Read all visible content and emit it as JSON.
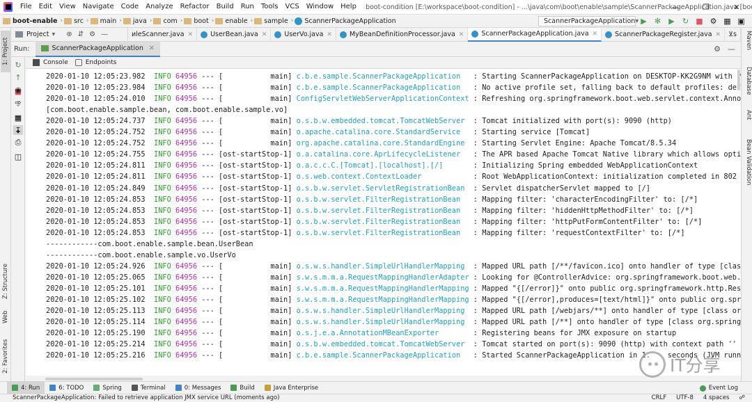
{
  "titlebar": {
    "menus": [
      "File",
      "Edit",
      "View",
      "Navigate",
      "Code",
      "Analyze",
      "Refactor",
      "Build",
      "Run",
      "Tools",
      "VCS",
      "Window",
      "Help"
    ],
    "title": "boot-condition [E:\\workspace\\boot-condition] - ...\\java\\com\\boot\\enable\\sample\\ScannerPackageApplication.java [boot-enable]"
  },
  "navbar": {
    "crumbs": [
      "boot-enable",
      "src",
      "main",
      "java",
      "com",
      "boot",
      "enable",
      "sample",
      "ScannerPackageApplication"
    ],
    "run_config": "ScannerPackageApplication"
  },
  "tabrow": {
    "project_label": "Project",
    "tabs": [
      "иleScanner.java",
      "UserBean.java",
      "UserVo.java",
      "MyBeanDefinitionProcessor.java",
      "ScannerPackageApplication.java",
      "ScannerPackageRegister.java",
      "⊻s"
    ],
    "active_tab": 4
  },
  "left_stripe": {
    "project": "1: Project",
    "structure": "Z: Structure",
    "web": "Web",
    "favorites": "2: Favorites"
  },
  "right_stripe": {
    "maven": "Maven",
    "database": "Database",
    "ant": "Ant",
    "bean_validation": "Bean Validation"
  },
  "runpanel": {
    "label": "Run:",
    "tab": "ScannerPackageApplication",
    "subtabs": [
      "Console",
      "Endpoints"
    ]
  },
  "console": {
    "lines": [
      {
        "date": "2020-01-10 12:05:23.982",
        "level": "INFO",
        "pid": "64956",
        "sep": " --- [",
        "thread": "           main]",
        "logger": "c.b.e.sample.ScannerPackageApplication  ",
        "msg": " : Starting ScannerPackageApplication on DESKTOP-KK2G9NM with PI"
      },
      {
        "date": "2020-01-10 12:05:23.984",
        "level": "INFO",
        "pid": "64956",
        "sep": " --- [",
        "thread": "           main]",
        "logger": "c.b.e.sample.ScannerPackageApplication  ",
        "msg": " : No active profile set, falling back to default profiles: defa"
      },
      {
        "date": "2020-01-10 12:05:24.010",
        "level": "INFO",
        "pid": "64956",
        "sep": " --- [",
        "thread": "           main]",
        "logger": "ConfigServletWebServerApplicationContext",
        "msg": " : Refreshing org.springframework.boot.web.servlet.context.Annot"
      },
      {
        "plain": "[com.boot.enable.sample.bean, com.boot.enable.sample.vo]"
      },
      {
        "date": "2020-01-10 12:05:24.737",
        "level": "INFO",
        "pid": "64956",
        "sep": " --- [",
        "thread": "           main]",
        "logger": "o.s.b.w.embedded.tomcat.TomcatWebServer ",
        "msg": " : Tomcat initialized with port(s): 9090 (http)"
      },
      {
        "date": "2020-01-10 12:05:24.752",
        "level": "INFO",
        "pid": "64956",
        "sep": " --- [",
        "thread": "           main]",
        "logger": "o.apache.catalina.core.StandardService  ",
        "msg": " : Starting service [Tomcat]"
      },
      {
        "date": "2020-01-10 12:05:24.752",
        "level": "INFO",
        "pid": "64956",
        "sep": " --- [",
        "thread": "           main]",
        "logger": "org.apache.catalina.core.StandardEngine ",
        "msg": " : Starting Servlet Engine: Apache Tomcat/8.5.34"
      },
      {
        "date": "2020-01-10 12:05:24.755",
        "level": "INFO",
        "pid": "64956",
        "sep": " --- [",
        "thread": "ost-startStop-1]",
        "logger": "o.a.catalina.core.AprLifecycleListener  ",
        "msg": " : The APR based Apache Tomcat Native library which allows optim"
      },
      {
        "date": "2020-01-10 12:05:24.811",
        "level": "INFO",
        "pid": "64956",
        "sep": " --- [",
        "thread": "ost-startStop-1]",
        "logger": "o.a.c.c.C.[Tomcat].[localhost].[/]      ",
        "msg": " : Initializing Spring embedded WebApplicationContext"
      },
      {
        "date": "2020-01-10 12:05:24.811",
        "level": "INFO",
        "pid": "64956",
        "sep": " --- [",
        "thread": "ost-startStop-1]",
        "logger": "o.s.web.context.ContextLoader           ",
        "msg": " : Root WebApplicationContext: initialization completed in 802 m"
      },
      {
        "date": "2020-01-10 12:05:24.849",
        "level": "INFO",
        "pid": "64956",
        "sep": " --- [",
        "thread": "ost-startStop-1]",
        "logger": "o.s.b.w.servlet.ServletRegistrationBean ",
        "msg": " : Servlet dispatcherServlet mapped to [/]"
      },
      {
        "date": "2020-01-10 12:05:24.853",
        "level": "INFO",
        "pid": "64956",
        "sep": " --- [",
        "thread": "ost-startStop-1]",
        "logger": "o.s.b.w.servlet.FilterRegistrationBean  ",
        "msg": " : Mapping filter: 'characterEncodingFilter' to: [/*]"
      },
      {
        "date": "2020-01-10 12:05:24.853",
        "level": "INFO",
        "pid": "64956",
        "sep": " --- [",
        "thread": "ost-startStop-1]",
        "logger": "o.s.b.w.servlet.FilterRegistrationBean  ",
        "msg": " : Mapping filter: 'hiddenHttpMethodFilter' to: [/*]"
      },
      {
        "date": "2020-01-10 12:05:24.853",
        "level": "INFO",
        "pid": "64956",
        "sep": " --- [",
        "thread": "ost-startStop-1]",
        "logger": "o.s.b.w.servlet.FilterRegistrationBean  ",
        "msg": " : Mapping filter: 'httpPutFormContentFilter' to: [/*]"
      },
      {
        "date": "2020-01-10 12:05:24.853",
        "level": "INFO",
        "pid": "64956",
        "sep": " --- [",
        "thread": "ost-startStop-1]",
        "logger": "o.s.b.w.servlet.FilterRegistrationBean  ",
        "msg": " : Mapping filter: 'requestContextFilter' to: [/*]"
      },
      {
        "plain": "------------com.boot.enable.sample.bean.UserBean"
      },
      {
        "plain": "------------com.boot.enable.sample.vo.UserVo"
      },
      {
        "date": "2020-01-10 12:05:24.926",
        "level": "INFO",
        "pid": "64956",
        "sep": " --- [",
        "thread": "           main]",
        "logger": "o.s.w.s.handler.SimpleUrlHandlerMapping ",
        "msg": " : Mapped URL path [/**/favicon.ico] onto handler of type [class"
      },
      {
        "date": "2020-01-10 12:05:25.065",
        "level": "INFO",
        "pid": "64956",
        "sep": " --- [",
        "thread": "           main]",
        "logger": "s.w.s.m.m.a.RequestMappingHandlerAdapter",
        "msg": " : Looking for @ControllerAdvice: org.springframework.boot.web.s"
      },
      {
        "date": "2020-01-10 12:05:25.101",
        "level": "INFO",
        "pid": "64956",
        "sep": " --- [",
        "thread": "           main]",
        "logger": "s.w.s.m.m.a.RequestMappingHandlerMapping",
        "msg": " : Mapped \"{[/error]}\" onto public org.springframework.http.Resp"
      },
      {
        "date": "2020-01-10 12:05:25.102",
        "level": "INFO",
        "pid": "64956",
        "sep": " --- [",
        "thread": "           main]",
        "logger": "s.w.s.m.m.a.RequestMappingHandlerMapping",
        "msg": " : Mapped \"{[/error],produces=[text/html]}\" onto public org.spri"
      },
      {
        "date": "2020-01-10 12:05:25.113",
        "level": "INFO",
        "pid": "64956",
        "sep": " --- [",
        "thread": "           main]",
        "logger": "o.s.w.s.handler.SimpleUrlHandlerMapping ",
        "msg": " : Mapped URL path [/webjars/**] onto handler of type [class org"
      },
      {
        "date": "2020-01-10 12:05:25.114",
        "level": "INFO",
        "pid": "64956",
        "sep": " --- [",
        "thread": "           main]",
        "logger": "o.s.w.s.handler.SimpleUrlHandlerMapping ",
        "msg": " : Mapped URL path [/**] onto handler of type [class org.springf"
      },
      {
        "date": "2020-01-10 12:05:25.190",
        "level": "INFO",
        "pid": "64956",
        "sep": " --- [",
        "thread": "           main]",
        "logger": "o.s.j.e.a.AnnotationMBeanExporter       ",
        "msg": " : Registering beans for JMX exposure on startup"
      },
      {
        "date": "2020-01-10 12:05:25.214",
        "level": "INFO",
        "pid": "64956",
        "sep": " --- [",
        "thread": "           main]",
        "logger": "o.s.b.w.embedded.tomcat.TomcatWebServer ",
        "msg": " : Tomcat started on port(s): 9090 (http) with context path ''"
      },
      {
        "date": "2020-01-10 12:05:25.216",
        "level": "INFO",
        "pid": "64956",
        "sep": " --- [",
        "thread": "           main]",
        "logger": "c.b.e.sample.ScannerPackageApplication  ",
        "msg": " : Started ScannerPackageApplication in 1.    seconds (JVM runni"
      }
    ]
  },
  "bottomtabs": {
    "tabs": [
      "4: Run",
      "6: TODO",
      "Spring",
      "Terminal",
      "0: Messages",
      "Build",
      "Java Enterprise"
    ],
    "event_log": "Event Log"
  },
  "statusbar": {
    "message": "ScannerPackageApplication: Failed to retrieve application JMX service URL (moments ago)",
    "line_sep": "CRLF",
    "encoding": "UTF-8",
    "indent": "4 spaces"
  },
  "watermark": {
    "text": "IT分享"
  },
  "colors": {
    "info": "#2ca02c",
    "pid": "#b52cb5",
    "logger": "#22a1c4",
    "accent": "#4083c9"
  }
}
